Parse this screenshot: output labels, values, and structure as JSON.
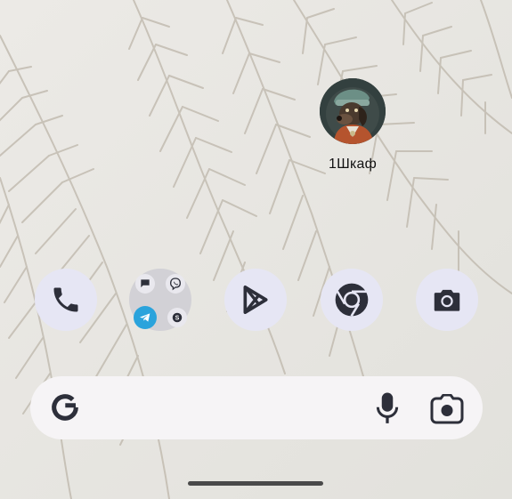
{
  "home": {
    "shortcut": {
      "label": "1Шкаф",
      "icon": "dog-avatar-icon"
    },
    "dock": [
      {
        "name": "phone",
        "icon": "phone-icon"
      },
      {
        "name": "messengers-folder",
        "icon": "folder-icon",
        "apps": [
          "messages-icon",
          "viber-icon",
          "telegram-icon",
          "skype-icon"
        ]
      },
      {
        "name": "play-store",
        "icon": "play-store-icon"
      },
      {
        "name": "chrome",
        "icon": "chrome-icon"
      },
      {
        "name": "camera",
        "icon": "camera-icon"
      }
    ],
    "search_bar": {
      "logo": "G",
      "voice_icon": "microphone-icon",
      "lens_icon": "lens-camera-icon"
    }
  },
  "colors": {
    "wallpaper": "#e8e7e3",
    "dock_bubble": "#e6e6f4",
    "icon_dark": "#2d2f3a",
    "telegram": "#2aa3dc",
    "folder_bg": "#d2d1d6"
  }
}
